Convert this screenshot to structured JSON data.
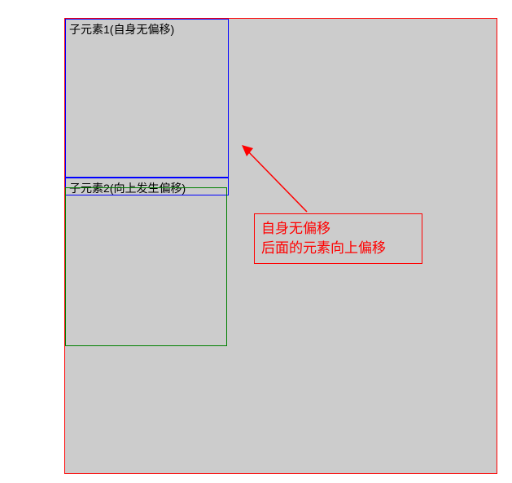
{
  "container": {
    "border_color": "#ff0000",
    "background": "#cccccc"
  },
  "child1": {
    "label": "子元素1(自身无偏移)",
    "border_color": "#0000ff"
  },
  "child2": {
    "label": "子元素2(向上发生偏移)",
    "blue_border_color": "#0000ff",
    "green_border_color": "#008000"
  },
  "annotation": {
    "line1": "自身无偏移",
    "line2": "后面的元素向上偏移",
    "color": "#ff0000"
  }
}
